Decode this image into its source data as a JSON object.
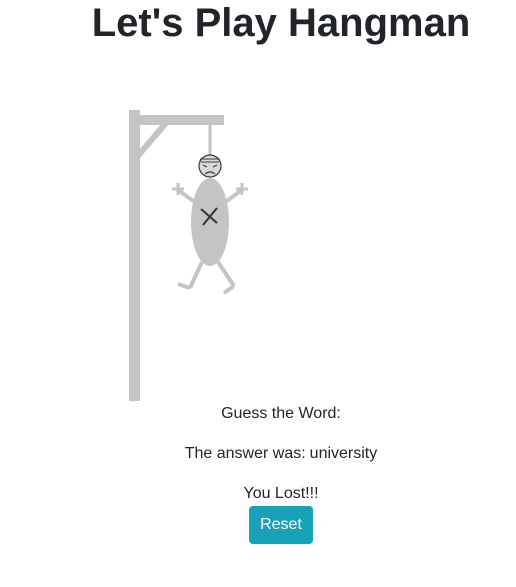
{
  "header": {
    "title": "Let's Play Hangman"
  },
  "game": {
    "prompt": "Guess the Word:",
    "answer_prefix": "The answer was:",
    "answer_word": "university",
    "result": "You Lost!!!",
    "reset_label": "Reset",
    "mistakes_drawn": 6,
    "max_mistakes": 6
  },
  "colors": {
    "gallows": "#c4c4c4",
    "figure": "#c4c4c4",
    "reset_button": "#17a2b8",
    "text": "#212529"
  },
  "icons": {
    "face": "dead-face-icon",
    "body_mark": "x-mark-icon"
  }
}
